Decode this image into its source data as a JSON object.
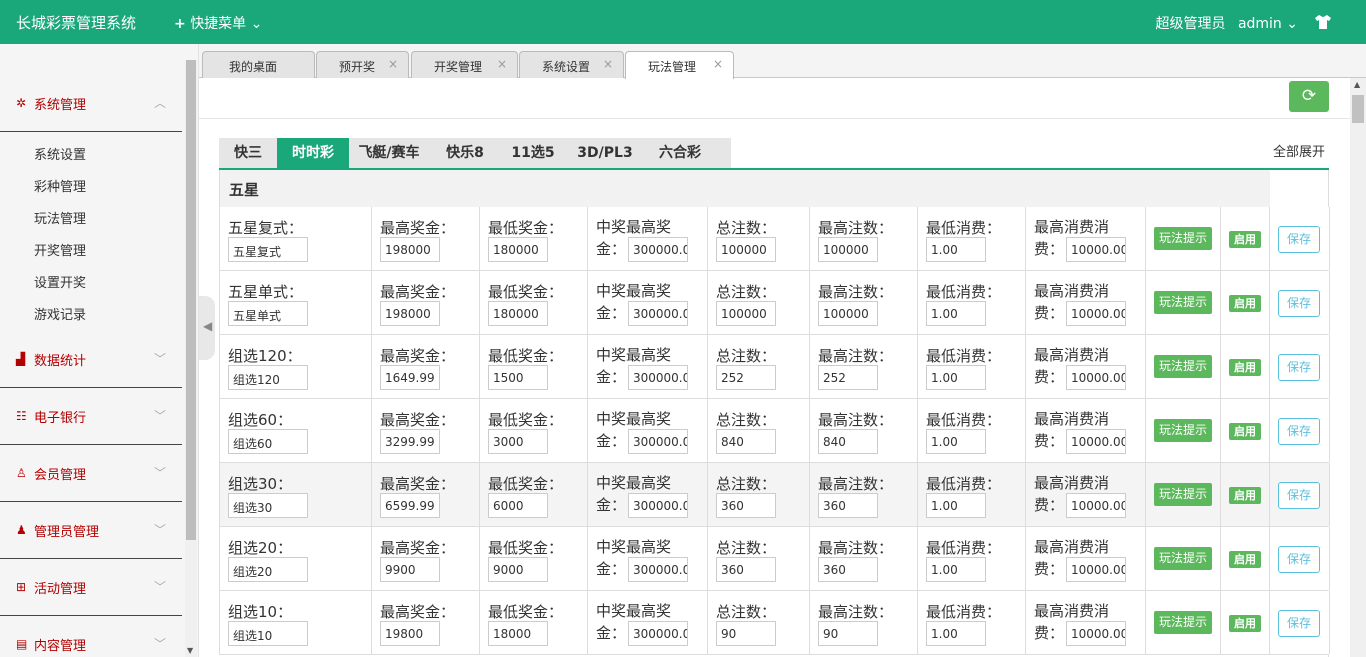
{
  "app": {
    "title": "长城彩票管理系统",
    "quick_menu": "快捷菜单",
    "admin_role": "超级管理员",
    "admin_name": "admin"
  },
  "sidebar": {
    "groups": [
      {
        "label": "系统管理",
        "icon": "gear-icon",
        "items": [
          "系统设置",
          "彩种管理",
          "玩法管理",
          "开奖管理",
          "设置开奖",
          "游戏记录"
        ]
      },
      {
        "label": "数据统计",
        "icon": "bar-chart-icon"
      },
      {
        "label": "电子银行",
        "icon": "list-icon"
      },
      {
        "label": "会员管理",
        "icon": "user-icon"
      },
      {
        "label": "管理员管理",
        "icon": "admin-icon"
      },
      {
        "label": "活动管理",
        "icon": "gift-icon"
      },
      {
        "label": "内容管理",
        "icon": "document-icon"
      }
    ]
  },
  "tabs": [
    {
      "label": "我的桌面",
      "closable": false
    },
    {
      "label": "预开奖",
      "closable": true
    },
    {
      "label": "开奖管理",
      "closable": true
    },
    {
      "label": "系统设置",
      "closable": true
    },
    {
      "label": "玩法管理",
      "closable": true,
      "active": true
    }
  ],
  "lottery_tabs": [
    "快三",
    "时时彩",
    "飞艇/赛车",
    "快乐8",
    "11选5",
    "3D/PL3",
    "六合彩"
  ],
  "active_lottery_tab": "时时彩",
  "expand_all": "全部展开",
  "section_title": "五星",
  "labels": {
    "max_prize": "最高奖金：",
    "min_prize": "最低奖金：",
    "max_win_1": "中奖最高奖",
    "max_win_2": "金：",
    "total_bets": "总注数：",
    "max_bets": "最高注数：",
    "min_spend": "最低消费：",
    "max_spend_1": "最高消费消",
    "max_spend_2": "费：",
    "tip_button": "玩法提示",
    "enable_badge": "启用",
    "save_button": "保存"
  },
  "rows": [
    {
      "label": "五星复式：",
      "name": "五星复式",
      "max_prize": "198000",
      "min_prize": "180000",
      "max_win": "300000.0",
      "total_bets": "100000",
      "max_bets": "100000",
      "min_spend": "1.00",
      "max_spend": "10000.00"
    },
    {
      "label": "五星单式：",
      "name": "五星单式",
      "max_prize": "198000",
      "min_prize": "180000",
      "max_win": "300000.0",
      "total_bets": "100000",
      "max_bets": "100000",
      "min_spend": "1.00",
      "max_spend": "10000.00"
    },
    {
      "label": "组选120：",
      "name": "组选120",
      "max_prize": "1649.99",
      "min_prize": "1500",
      "max_win": "300000.0",
      "total_bets": "252",
      "max_bets": "252",
      "min_spend": "1.00",
      "max_spend": "10000.00"
    },
    {
      "label": "组选60：",
      "name": "组选60",
      "max_prize": "3299.99",
      "min_prize": "3000",
      "max_win": "300000.0",
      "total_bets": "840",
      "max_bets": "840",
      "min_spend": "1.00",
      "max_spend": "10000.00"
    },
    {
      "label": "组选30：",
      "name": "组选30",
      "max_prize": "6599.99",
      "min_prize": "6000",
      "max_win": "300000.0",
      "total_bets": "360",
      "max_bets": "360",
      "min_spend": "1.00",
      "max_spend": "10000.00"
    },
    {
      "label": "组选20：",
      "name": "组选20",
      "max_prize": "9900",
      "min_prize": "9000",
      "max_win": "300000.0",
      "total_bets": "360",
      "max_bets": "360",
      "min_spend": "1.00",
      "max_spend": "10000.00"
    },
    {
      "label": "组选10：",
      "name": "组选10",
      "max_prize": "19800",
      "min_prize": "18000",
      "max_win": "300000.0",
      "total_bets": "90",
      "max_bets": "90",
      "min_spend": "1.00",
      "max_spend": "10000.00"
    }
  ]
}
